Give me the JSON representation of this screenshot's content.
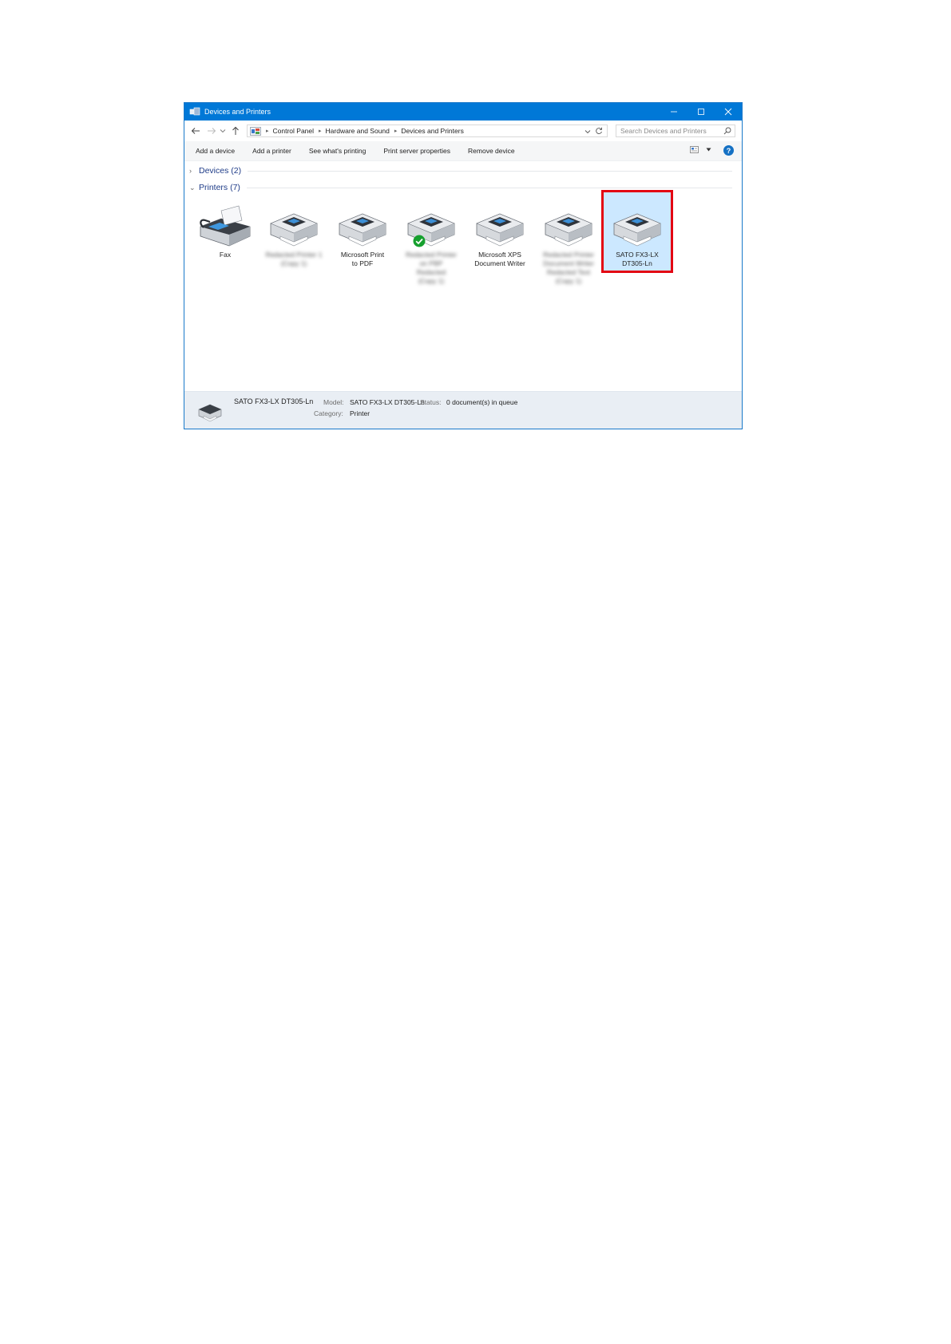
{
  "window": {
    "title": "Devices and Printers",
    "accent": "#0078d7"
  },
  "address": {
    "crumbs": [
      "Control Panel",
      "Hardware and Sound",
      "Devices and Printers"
    ],
    "search_placeholder": "Search Devices and Printers"
  },
  "commands": [
    "Add a device",
    "Add a printer",
    "See what's printing",
    "Print server properties",
    "Remove device"
  ],
  "help_label": "?",
  "groups": {
    "devices": {
      "label": "Devices (2)",
      "collapsed": true
    },
    "printers": {
      "label": "Printers (7)",
      "collapsed": false
    }
  },
  "printers": [
    {
      "lines": [
        "Fax"
      ],
      "blurred": false,
      "icon": "fax-icon"
    },
    {
      "lines": [
        "Redacted Printer 1",
        "(Copy 1)"
      ],
      "blurred": true,
      "icon": "printer-icon"
    },
    {
      "lines": [
        "Microsoft Print",
        "to PDF"
      ],
      "blurred": false,
      "icon": "printer-icon"
    },
    {
      "lines": [
        "Redacted Printer",
        "on PBP",
        "Redacted",
        "(Copy 1)"
      ],
      "blurred": true,
      "icon": "printer-icon",
      "default": true
    },
    {
      "lines": [
        "Microsoft XPS",
        "Document Writer"
      ],
      "blurred": false,
      "icon": "printer-icon"
    },
    {
      "lines": [
        "Redacted Printer",
        "Document Writer",
        "Redacted Text",
        "(Copy 1)"
      ],
      "blurred": true,
      "icon": "printer-icon"
    },
    {
      "lines": [
        "SATO FX3-LX",
        "DT305-Ln"
      ],
      "blurred": false,
      "icon": "printer-icon",
      "selected": true
    }
  ],
  "status": {
    "name": "SATO FX3-LX DT305-Ln",
    "model_label": "Model:",
    "model_value": "SATO FX3-LX DT305-Ln",
    "status_label": "Status:",
    "status_value": "0 document(s) in queue",
    "category_label": "Category:",
    "category_value": "Printer"
  },
  "highlight_color": "#e30613"
}
